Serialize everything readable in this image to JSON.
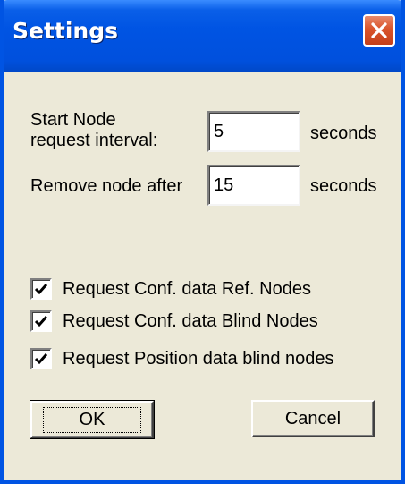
{
  "window": {
    "title": "Settings"
  },
  "fields": {
    "start_node_label_line1": "Start Node",
    "start_node_label_line2": "request interval:",
    "start_node_value": "5",
    "start_node_unit": "seconds",
    "remove_node_label": "Remove node after",
    "remove_node_value": "15",
    "remove_node_unit": "seconds"
  },
  "checkboxes": [
    {
      "label": "Request Conf. data Ref. Nodes",
      "checked": true
    },
    {
      "label": "Request Conf. data Blind Nodes",
      "checked": true
    },
    {
      "label": "Request Position data blind nodes",
      "checked": true
    }
  ],
  "buttons": {
    "ok_label": "OK",
    "cancel_label": "Cancel"
  },
  "colors": {
    "titlebar": "#0054e3",
    "dialog_face": "#ece9d8",
    "close_button": "#d9542b"
  },
  "icons": {
    "close": "close-icon",
    "check": "checkmark-icon"
  }
}
